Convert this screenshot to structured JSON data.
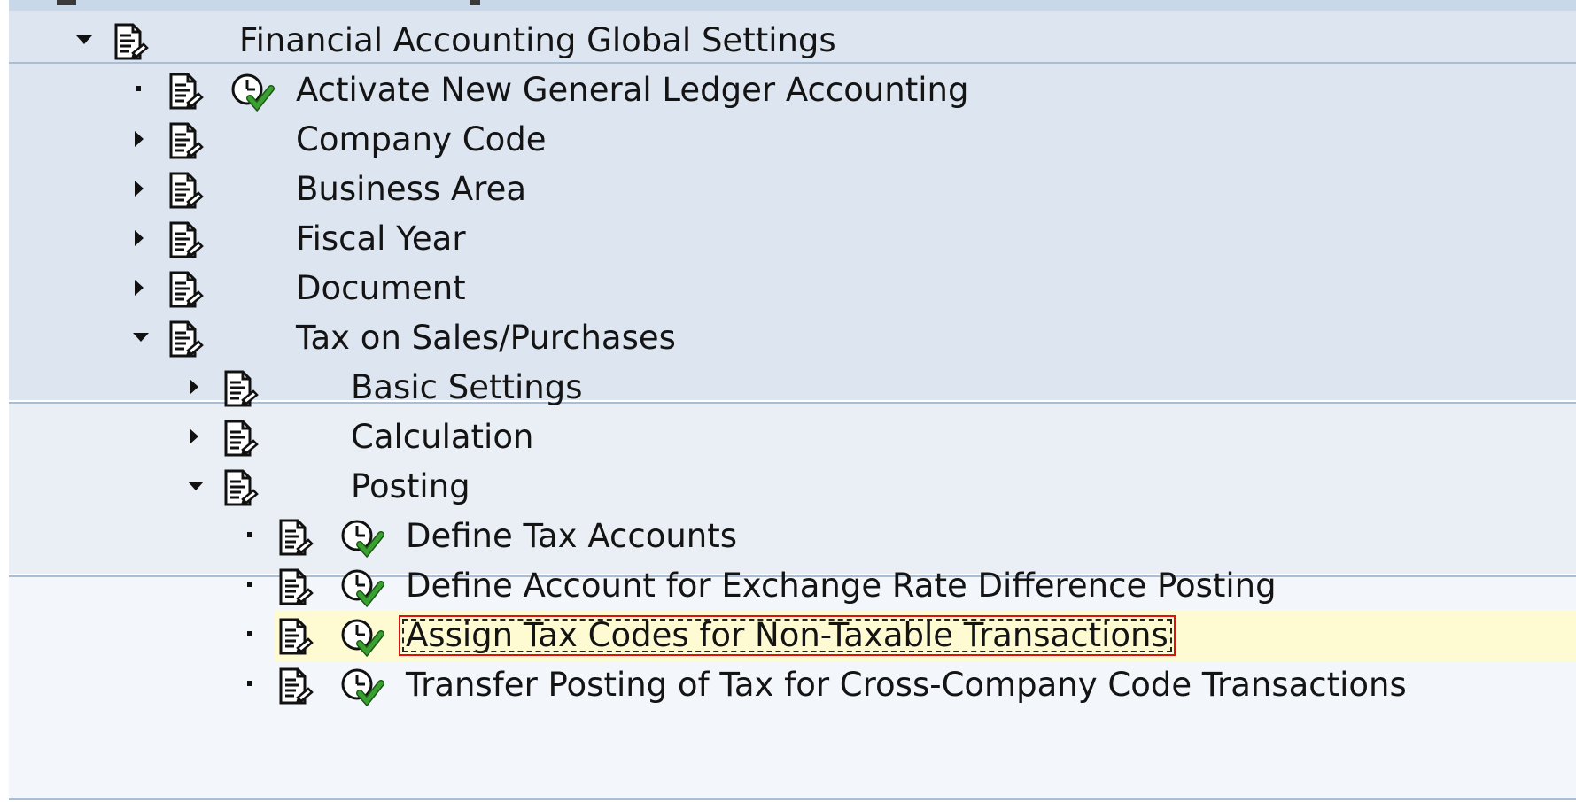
{
  "tree": {
    "root": {
      "label": "Financial Accounting Global Settings",
      "expanded": true,
      "icon": "document-icon"
    },
    "level1": [
      {
        "label": "Activate New General Ledger Accounting",
        "type": "activity",
        "icon": "document-icon",
        "status_icon": "clock-check-icon"
      },
      {
        "label": "Company Code",
        "type": "folder",
        "expanded": false,
        "icon": "document-icon"
      },
      {
        "label": "Business Area",
        "type": "folder",
        "expanded": false,
        "icon": "document-icon"
      },
      {
        "label": "Fiscal Year",
        "type": "folder",
        "expanded": false,
        "icon": "document-icon"
      },
      {
        "label": "Document",
        "type": "folder",
        "expanded": false,
        "icon": "document-icon"
      },
      {
        "label": "Tax on Sales/Purchases",
        "type": "folder",
        "expanded": true,
        "icon": "document-icon"
      }
    ],
    "level2": [
      {
        "label": "Basic Settings",
        "type": "folder",
        "expanded": false,
        "icon": "document-icon"
      },
      {
        "label": "Calculation",
        "type": "folder",
        "expanded": false,
        "icon": "document-icon"
      },
      {
        "label": "Posting",
        "type": "folder",
        "expanded": true,
        "icon": "document-icon"
      }
    ],
    "level3": [
      {
        "label": "Define Tax Accounts",
        "type": "activity",
        "icon": "document-icon",
        "status_icon": "clock-check-icon",
        "selected": false
      },
      {
        "label": "Define Account for Exchange Rate Difference Posting",
        "type": "activity",
        "icon": "document-icon",
        "status_icon": "clock-check-icon",
        "selected": false
      },
      {
        "label": "Assign Tax Codes for Non-Taxable Transactions",
        "type": "activity",
        "icon": "document-icon",
        "status_icon": "clock-check-icon",
        "selected": true
      },
      {
        "label": "Transfer Posting of Tax for Cross-Company Code Transactions",
        "type": "activity",
        "icon": "document-icon",
        "status_icon": "clock-check-icon",
        "selected": false
      }
    ]
  },
  "colors": {
    "band_level1": "#dde6f0",
    "band_level2": "#e9eff5",
    "band_level3": "#f3f6fa",
    "selection_background": "#fefbd2",
    "selection_border": "#e01010",
    "clock_check": "#3aa032"
  }
}
